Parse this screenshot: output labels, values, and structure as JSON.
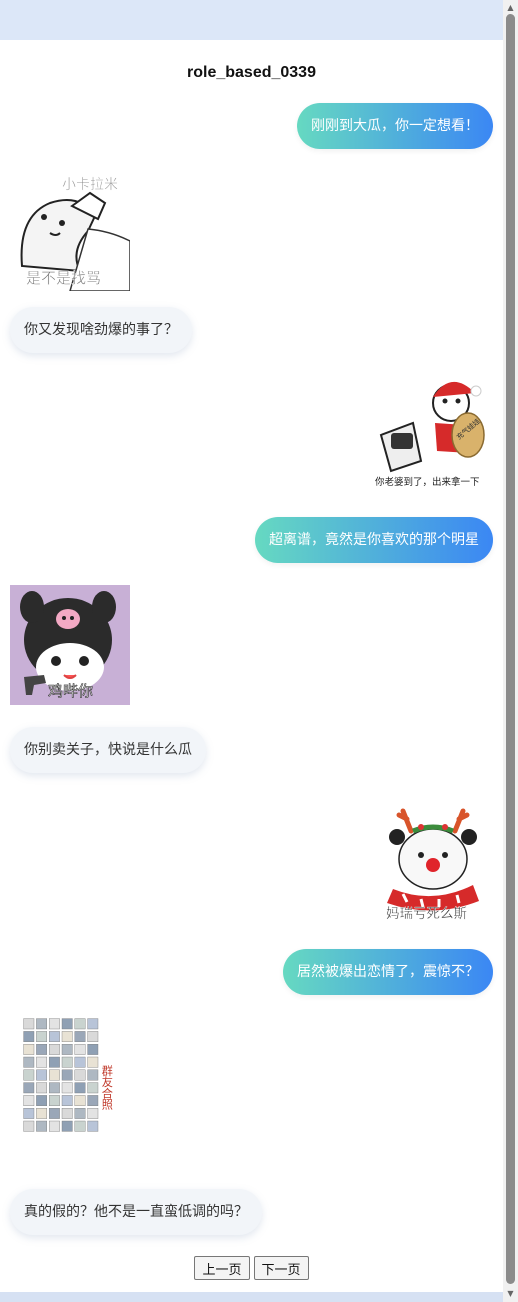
{
  "page": {
    "title": "role_based_0339"
  },
  "messages": [
    {
      "side": "right",
      "type": "text",
      "text": "刚刚到大瓜，你一定想看！"
    },
    {
      "side": "left",
      "type": "sticker",
      "icon": "snowman-sticker",
      "caption": "是不是找骂",
      "top_text": "小卡拉米"
    },
    {
      "side": "left",
      "type": "text",
      "text": "你又发现啥劲爆的事了？"
    },
    {
      "side": "right",
      "type": "sticker",
      "icon": "santa-bag-sticker",
      "caption": "你老婆到了，出来拿一下",
      "top_text": "充气娃娃"
    },
    {
      "side": "right",
      "type": "text",
      "text": "超离谱，竟然是你喜欢的那个明星"
    },
    {
      "side": "left",
      "type": "sticker",
      "icon": "kuromi-gun-sticker",
      "caption": "鸡哔你"
    },
    {
      "side": "left",
      "type": "text",
      "text": "你别卖关子，快说是什么瓜"
    },
    {
      "side": "right",
      "type": "sticker",
      "icon": "reindeer-panda-sticker",
      "caption": "妈瑞亏死么斯"
    },
    {
      "side": "right",
      "type": "text",
      "text": "居然被爆出恋情了，震惊不？"
    },
    {
      "side": "left",
      "type": "sticker",
      "icon": "group-photo-sticker",
      "caption": "群友合照"
    },
    {
      "side": "left",
      "type": "text",
      "text": "真的假的？他不是一直蛮低调的吗？"
    }
  ],
  "pager": {
    "prev_label": "上一页",
    "next_label": "下一页"
  },
  "colors": {
    "gradient_start": "#66d9c1",
    "gradient_end": "#3b87f4",
    "left_bubble": "#f2f5f9"
  }
}
